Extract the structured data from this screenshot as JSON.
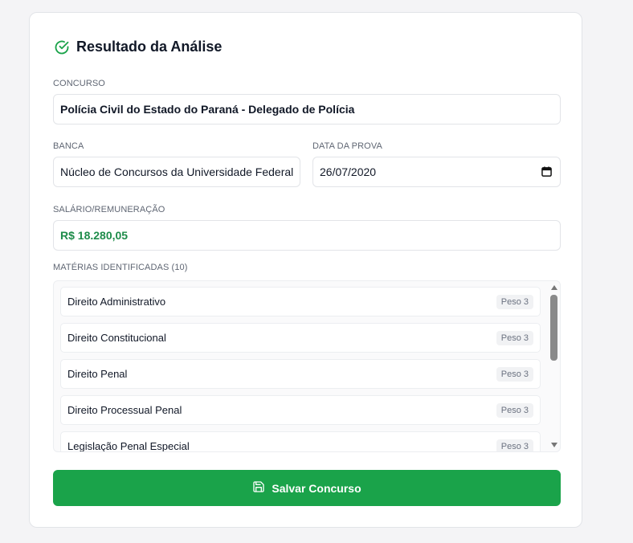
{
  "header": {
    "title": "Resultado da Análise",
    "icon": "check-circle-icon",
    "icon_color": "#1aa34a"
  },
  "concurso": {
    "label": "CONCURSO",
    "value": "Polícia Civil do Estado do Paraná - Delegado de Polícia"
  },
  "banca": {
    "label": "BANCA",
    "value": "Núcleo de Concursos da Universidade Federal"
  },
  "data_prova": {
    "label": "DATA DA PROVA",
    "value": "26/07/2020",
    "icon": "calendar-icon"
  },
  "salario": {
    "label": "SALÁRIO/REMUNERAÇÃO",
    "value": "R$ 18.280,05",
    "color": "#1e8c4a"
  },
  "materias": {
    "label": "MATÉRIAS IDENTIFICADAS (10)",
    "items": [
      {
        "name": "Direito Administrativo",
        "weight": "Peso 3"
      },
      {
        "name": "Direito Constitucional",
        "weight": "Peso 3"
      },
      {
        "name": "Direito Penal",
        "weight": "Peso 3"
      },
      {
        "name": "Direito Processual Penal",
        "weight": "Peso 3"
      },
      {
        "name": "Legislação Penal Especial",
        "weight": "Peso 3"
      }
    ]
  },
  "actions": {
    "save_label": "Salvar Concurso",
    "save_icon": "save-icon",
    "accent": "#1aa34a"
  }
}
